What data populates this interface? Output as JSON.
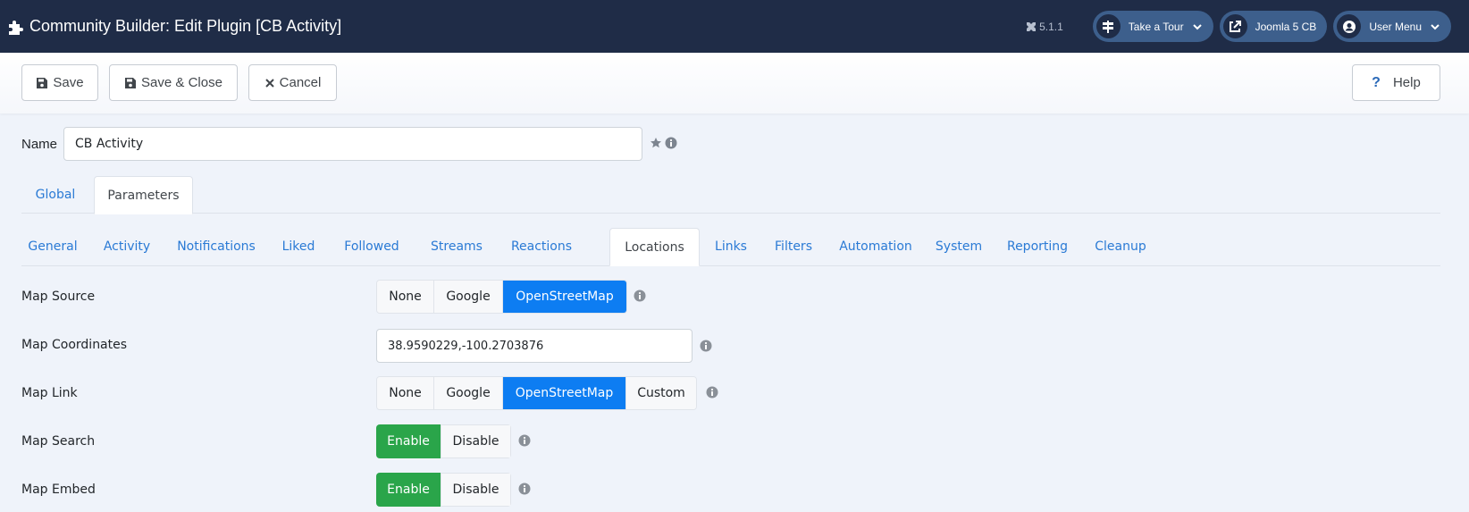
{
  "header": {
    "title": "Community Builder: Edit Plugin [CB Activity]",
    "version": "5.1.1",
    "take_tour": "Take a Tour",
    "site_link": "Joomla 5 CB",
    "user_menu": "User Menu"
  },
  "toolbar": {
    "save": "Save",
    "save_close": "Save & Close",
    "cancel": "Cancel",
    "help_symbol": "?",
    "help": "Help"
  },
  "name_field": {
    "label": "Name",
    "value": "CB Activity"
  },
  "top_tabs": [
    {
      "label": "Global",
      "active": false
    },
    {
      "label": "Parameters",
      "active": true
    }
  ],
  "sub_tabs": [
    {
      "label": "General",
      "active": false
    },
    {
      "label": "Activity",
      "active": false
    },
    {
      "label": "Notifications",
      "active": false
    },
    {
      "label": "Liked",
      "active": false
    },
    {
      "label": "Followed",
      "active": false
    },
    {
      "label": "Streams",
      "active": false
    },
    {
      "label": "Reactions",
      "active": false
    },
    {
      "label": "Locations",
      "active": true
    },
    {
      "label": "Links",
      "active": false
    },
    {
      "label": "Filters",
      "active": false
    },
    {
      "label": "Automation",
      "active": false
    },
    {
      "label": "System",
      "active": false
    },
    {
      "label": "Reporting",
      "active": false
    },
    {
      "label": "Cleanup",
      "active": false
    }
  ],
  "fields": {
    "map_source": {
      "label": "Map Source",
      "options": [
        "None",
        "Google",
        "OpenStreetMap"
      ],
      "selected": "OpenStreetMap"
    },
    "map_coordinates": {
      "label": "Map Coordinates",
      "value": "38.9590229,-100.2703876"
    },
    "map_link": {
      "label": "Map Link",
      "options": [
        "None",
        "Google",
        "OpenStreetMap",
        "Custom"
      ],
      "selected": "OpenStreetMap"
    },
    "map_search": {
      "label": "Map Search",
      "options": [
        "Enable",
        "Disable"
      ],
      "selected": "Enable"
    },
    "map_embed": {
      "label": "Map Embed",
      "options": [
        "Enable",
        "Disable"
      ],
      "selected": "Enable"
    }
  },
  "colors": {
    "header_bg": "#1f2c47",
    "pill_bg": "#3d5f8c",
    "link_blue": "#2a7ad5",
    "selected_blue": "#0d7df2",
    "selected_green": "#2aa54a"
  }
}
